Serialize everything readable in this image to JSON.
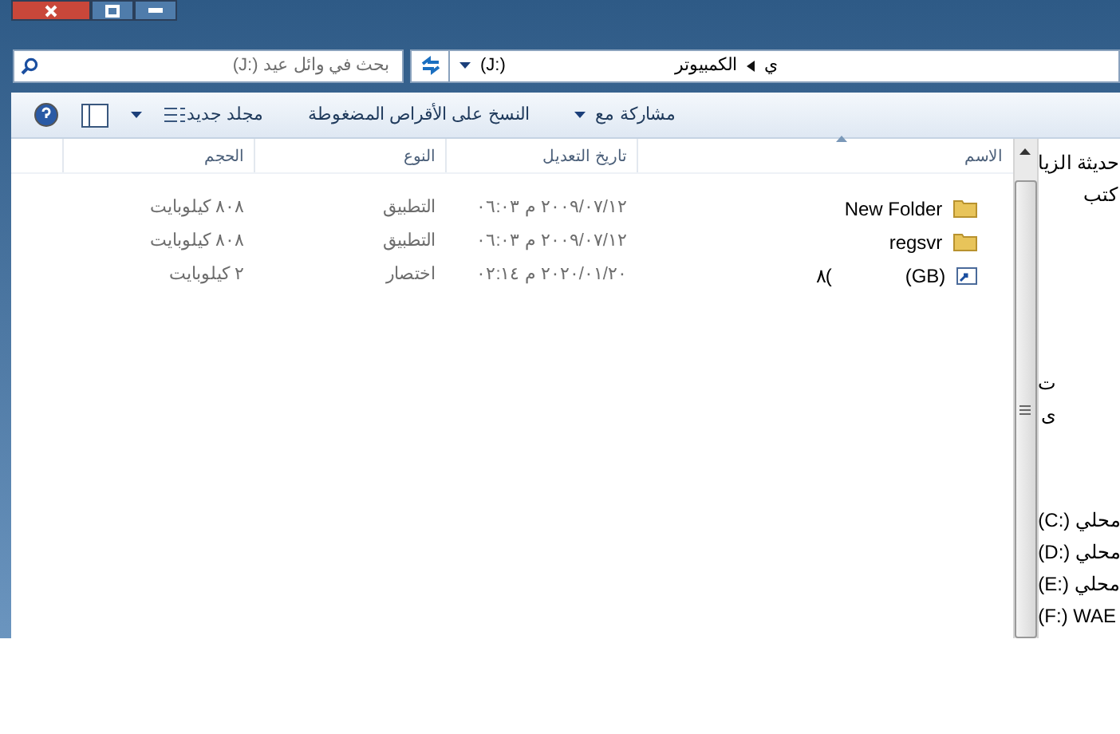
{
  "window": {
    "buttons": [
      {
        "kind": "close"
      },
      {
        "kind": "maximize"
      },
      {
        "kind": "minimize"
      }
    ]
  },
  "address": {
    "crumbs": [
      "ي",
      "الكمبيوتر",
      "(J:)"
    ]
  },
  "search": {
    "placeholder": "(J:) بحث في وائل عيد"
  },
  "toolbar": {
    "items": [
      {
        "label": "مشاركة مع",
        "dropdown": true
      },
      {
        "label": "النسخ على الأقراص المضغوطة",
        "dropdown": false
      },
      {
        "label": "مجلد جديد",
        "dropdown": false
      }
    ]
  },
  "columns": [
    "الاسم",
    "تاريخ التعديل",
    "النوع",
    "الحجم"
  ],
  "rows": [
    {
      "kind": "folder",
      "name": "New Folder",
      "modified": "٢٠٠٩/٠٧/١٢ م ٠٦:٠٣",
      "type": "التطبيق",
      "size": "٨٠٨ كيلوبايت"
    },
    {
      "kind": "folder",
      "name": "regsvr",
      "modified": "٢٠٠٩/٠٧/١٢ م ٠٦:٠٣",
      "type": "التطبيق",
      "size": "٨٠٨ كيلوبايت"
    },
    {
      "kind": "shortcut",
      "name": "(GB)",
      "name_tail": "٨(",
      "modified": "٢٠٢٠/٠١/٢٠ م ٠٢:١٤",
      "type": "اختصار",
      "size": "٢ كيلوبايت"
    }
  ],
  "nav": {
    "groups": [
      [
        "حديثة الزيا",
        "كتب"
      ],
      [
        "ت",
        "ى"
      ],
      [
        "(C:) محلي",
        "(D:) محلي",
        "(E:) محلي",
        "(F:) WAE"
      ]
    ]
  }
}
